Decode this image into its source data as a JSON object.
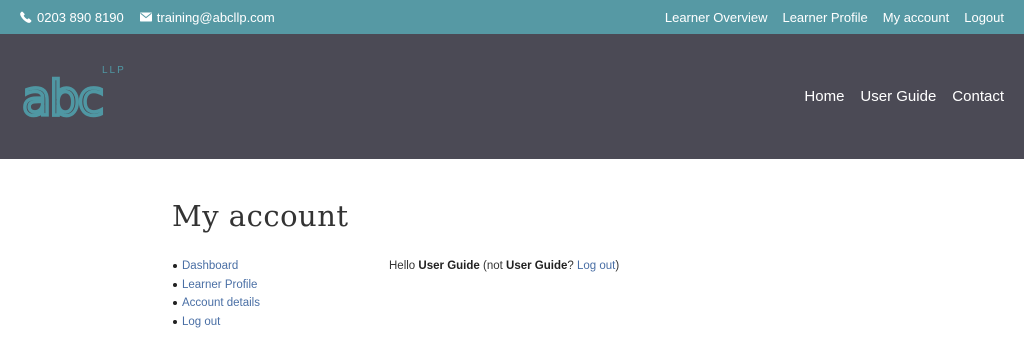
{
  "topbar": {
    "phone": "0203 890 8190",
    "email": "training@abcllp.com",
    "links": [
      "Learner Overview",
      "Learner Profile",
      "My account",
      "Logout"
    ]
  },
  "header": {
    "logo": {
      "main": "abc",
      "suffix": "LLP"
    },
    "nav": [
      "Home",
      "User Guide",
      "Contact"
    ]
  },
  "main": {
    "title": "My account",
    "account_nav": [
      "Dashboard",
      "Learner Profile",
      "Account details",
      "Log out"
    ],
    "greeting": {
      "hello": "Hello",
      "user": "User Guide",
      "not_open": "(not",
      "user_again": "User Guide",
      "question": "?",
      "logout_link": "Log out",
      "close": ")"
    }
  },
  "colors": {
    "topbar_bg": "#5699a4",
    "header_bg": "#4b4a55",
    "logo_teal": "#4f97a3",
    "link_blue": "#4a6fa5"
  },
  "icons": [
    "phone-icon",
    "envelope-icon"
  ]
}
